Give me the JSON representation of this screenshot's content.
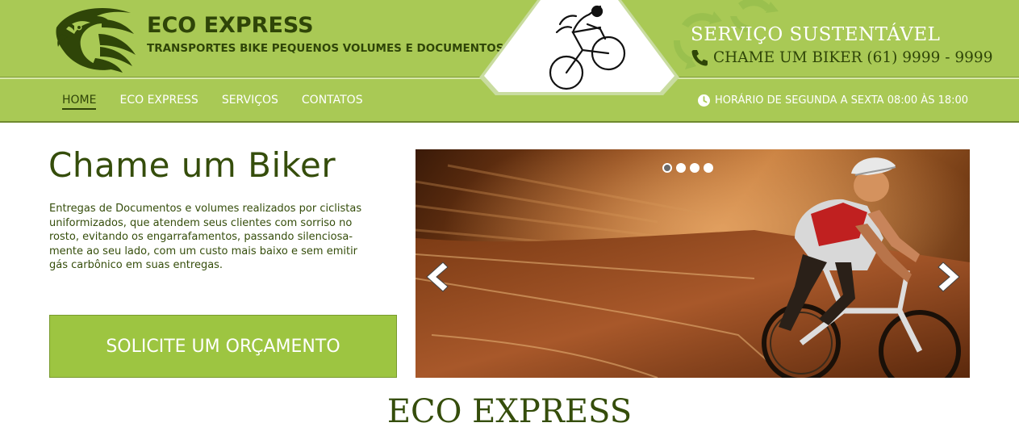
{
  "header": {
    "brand_title": "ECO EXPRESS",
    "brand_subtitle": "TRANSPORTES BIKE PEQUENOS VOLUMES E DOCUMENTOS",
    "service_title": "SERVIÇO SUSTENTÁVEL",
    "phone_text": "CHAME UM BIKER (61) 9999 - 9999",
    "hours_text": "HORÁRIO DE SEGUNDA A SEXTA 08:00 ÀS 18:00",
    "logo_icon": "eagle-icon",
    "badge_icon": "cyclist-icon",
    "phone_icon": "phone-icon",
    "clock_icon": "clock-icon",
    "colors": {
      "green": "#a9c955",
      "dark_green": "#2f4508",
      "white": "#ffffff"
    }
  },
  "nav": {
    "items": [
      {
        "label": "HOME",
        "active": true
      },
      {
        "label": "ECO EXPRESS",
        "active": false
      },
      {
        "label": "SERVIÇOS",
        "active": false
      },
      {
        "label": "CONTATOS",
        "active": false
      }
    ]
  },
  "hero": {
    "title": "Chame um Biker",
    "text_lines": [
      "Entregas de Documentos e volumes realizados por ciclistas",
      "uniformizados, que atendem seus clientes com sorriso no",
      "rosto, evitando os engarrafamentos, passando silenciosa-",
      "mente ao seu lado, com um custo mais baixo e sem emitir",
      "gás carbônico em suas entregas."
    ],
    "cta_label": "SOLICITE UM ORÇAMENTO"
  },
  "slider": {
    "dots": [
      {
        "active": true
      },
      {
        "active": false
      },
      {
        "active": false
      },
      {
        "active": false
      }
    ],
    "prev_icon": "chevron-left-icon",
    "next_icon": "chevron-right-icon"
  },
  "section": {
    "title": "ECO EXPRESS"
  }
}
